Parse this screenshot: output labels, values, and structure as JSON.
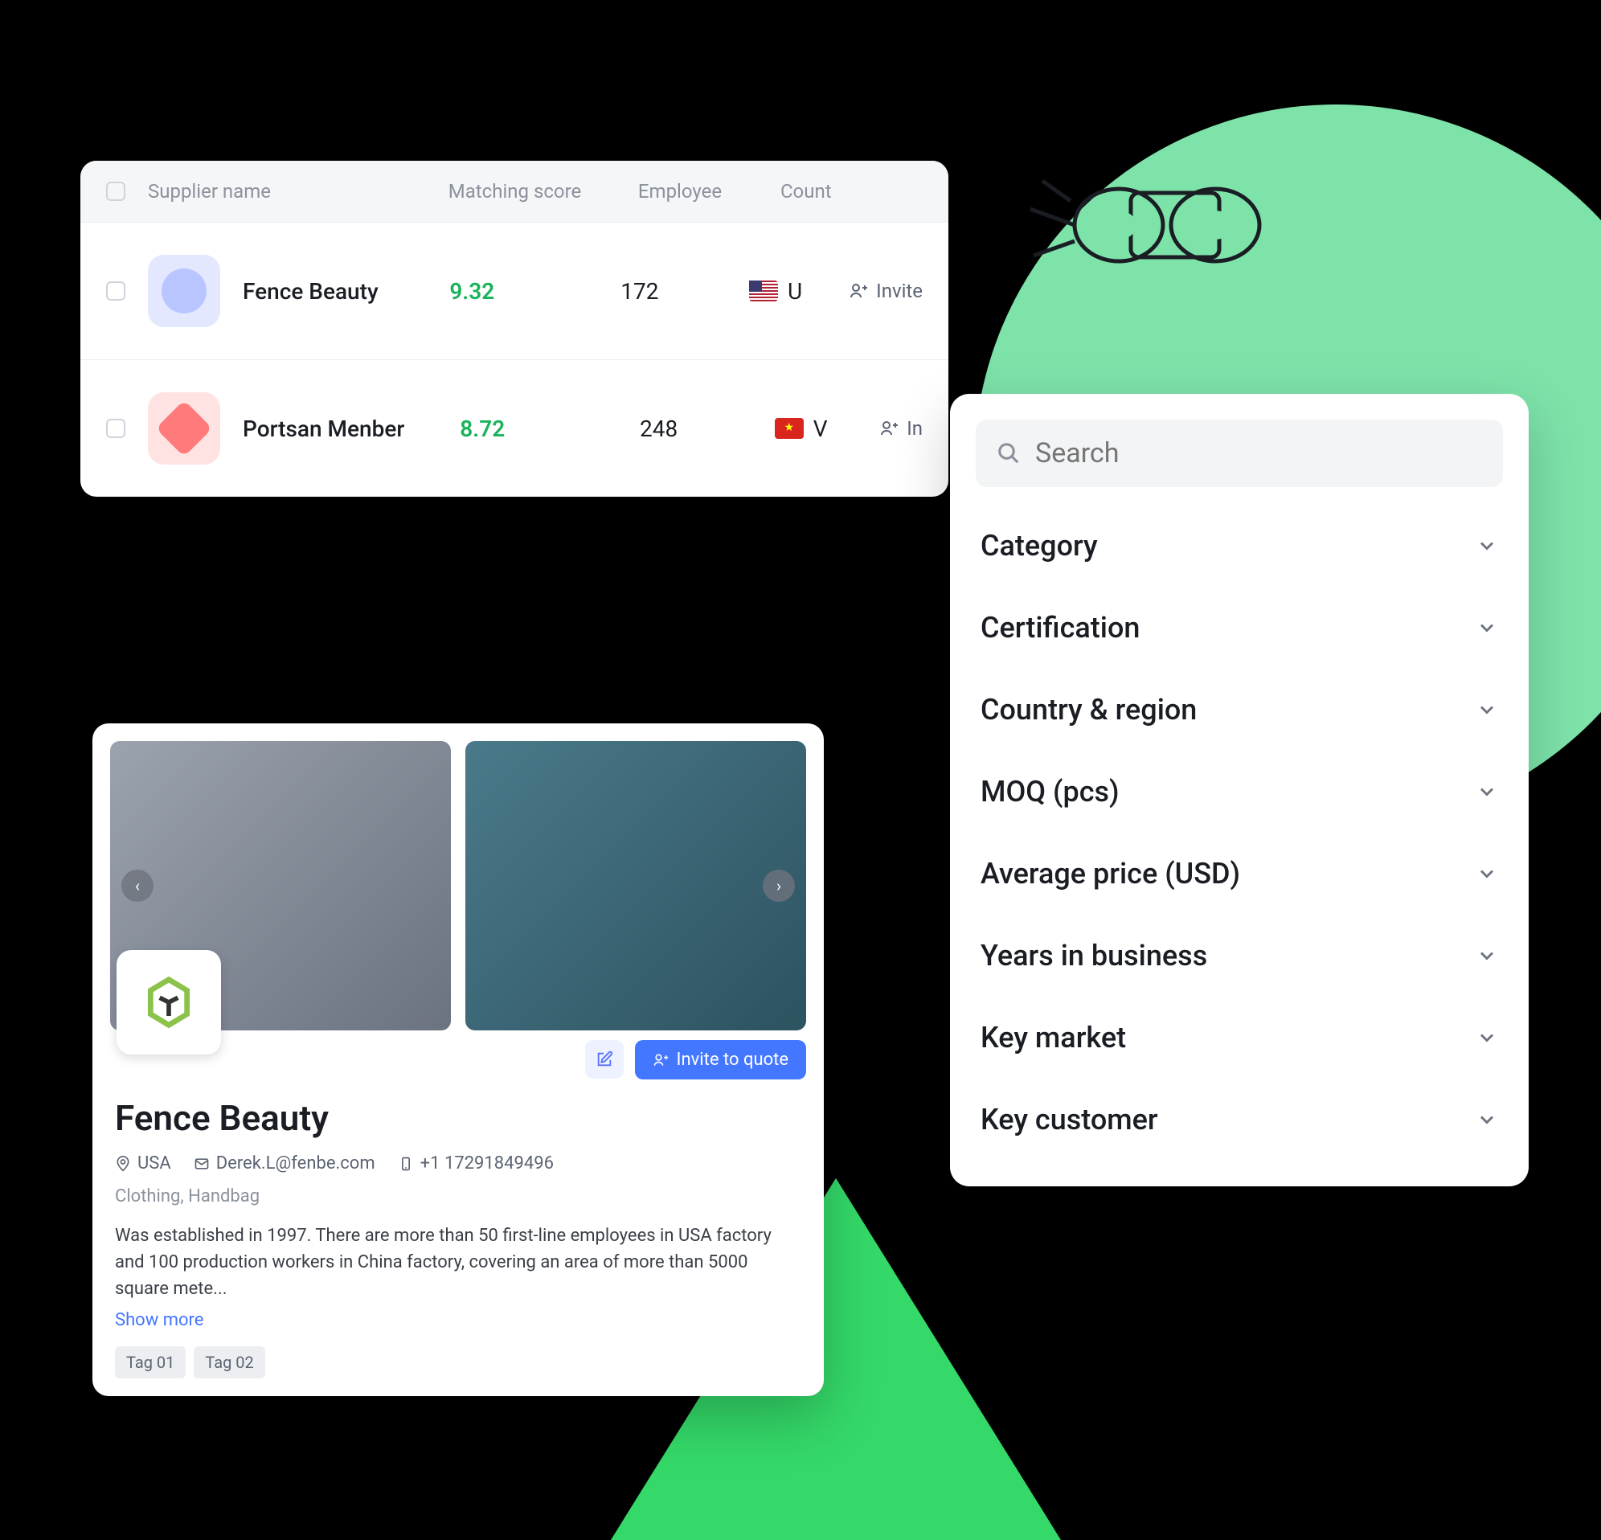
{
  "table": {
    "headers": {
      "name": "Supplier name",
      "score": "Matching score",
      "employee": "Employee",
      "country": "Count"
    },
    "rows": [
      {
        "name": "Fence Beauty",
        "score": "9.32",
        "employee": "172",
        "countryCode": "U",
        "invite": "Invite"
      },
      {
        "name": "Portsan Menber",
        "score": "8.72",
        "employee": "248",
        "countryCode": "V",
        "invite": "In"
      }
    ]
  },
  "filters": {
    "searchPlaceholder": "Search",
    "items": [
      "Category",
      "Certification",
      "Country & region",
      "MOQ (pcs)",
      "Average price (USD)",
      "Years in business",
      "Key market",
      "Key customer"
    ]
  },
  "detail": {
    "title": "Fence Beauty",
    "country": "USA",
    "email": "Derek.L@fenbe.com",
    "phone": "+1 17291849496",
    "categories": "Clothing, Handbag",
    "description": "Was established in 1997. There are more than 50 first-line employees in USA factory and 100 production workers in China factory, covering an area of more than 5000 square mete...",
    "showMore": "Show more",
    "tags": [
      "Tag 01",
      "Tag 02"
    ],
    "inviteLabel": "Invite to quote"
  }
}
